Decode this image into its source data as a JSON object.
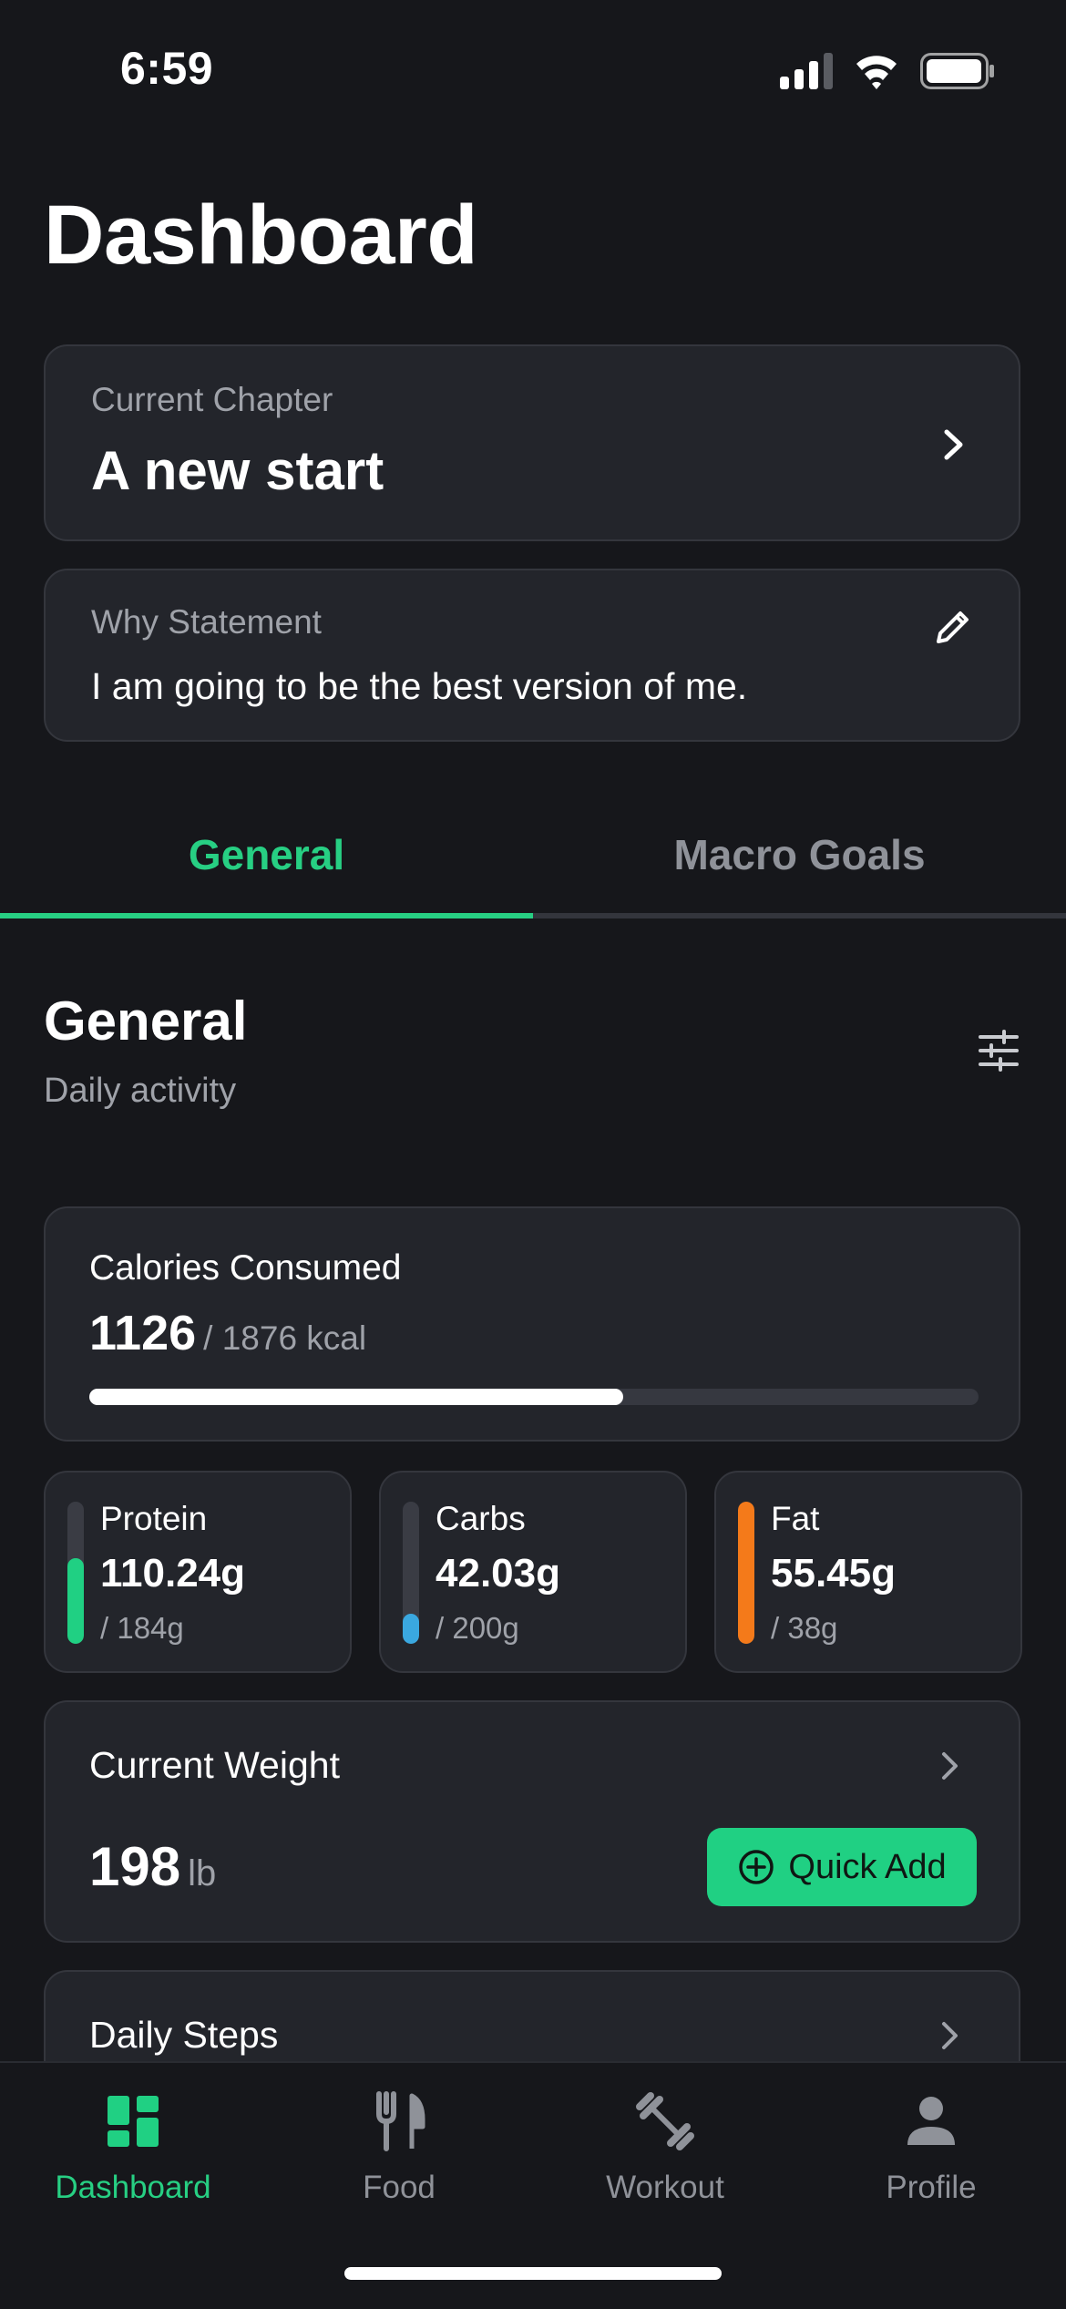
{
  "status_bar": {
    "time": "6:59"
  },
  "page": {
    "title": "Dashboard"
  },
  "chapter": {
    "label": "Current Chapter",
    "title": "A new start"
  },
  "why": {
    "label": "Why Statement",
    "text": "I am going to be the best version of me."
  },
  "tabs": [
    {
      "label": "General",
      "active": true
    },
    {
      "label": "Macro Goals",
      "active": false
    }
  ],
  "section": {
    "title": "General",
    "subtitle": "Daily activity"
  },
  "calories": {
    "label": "Calories Consumed",
    "consumed": "1126",
    "goal": "/ 1876 kcal",
    "progress": 0.6
  },
  "macros": [
    {
      "name": "Protein",
      "value": "110.24g",
      "goal": "/ 184g",
      "color": "#20d083",
      "fill": 0.6
    },
    {
      "name": "Carbs",
      "value": "42.03g",
      "goal": "/ 200g",
      "color": "#3aa8e0",
      "fill": 0.21
    },
    {
      "name": "Fat",
      "value": "55.45g",
      "goal": "/ 38g",
      "color": "#f47a1a",
      "fill": 1.0
    }
  ],
  "weight": {
    "label": "Current Weight",
    "value": "198",
    "unit": "lb",
    "quick_add_label": "Quick Add"
  },
  "steps": {
    "label": "Daily Steps"
  },
  "nav": [
    {
      "label": "Dashboard",
      "icon": "dashboard-icon",
      "active": true
    },
    {
      "label": "Food",
      "icon": "utensils-icon",
      "active": false
    },
    {
      "label": "Workout",
      "icon": "dumbbell-icon",
      "active": false
    },
    {
      "label": "Profile",
      "icon": "person-icon",
      "active": false
    }
  ],
  "colors": {
    "accent": "#27cf83",
    "background": "#16171b",
    "card": "#23252b"
  }
}
